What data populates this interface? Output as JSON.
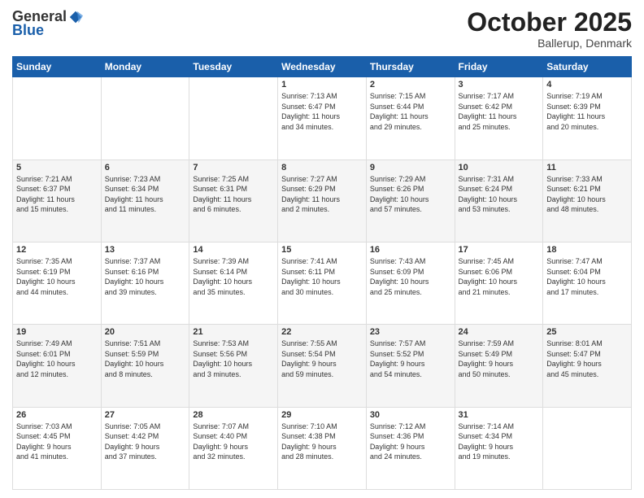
{
  "logo": {
    "general": "General",
    "blue": "Blue"
  },
  "header": {
    "month": "October 2025",
    "location": "Ballerup, Denmark"
  },
  "days_of_week": [
    "Sunday",
    "Monday",
    "Tuesday",
    "Wednesday",
    "Thursday",
    "Friday",
    "Saturday"
  ],
  "weeks": [
    [
      {
        "day": "",
        "info": ""
      },
      {
        "day": "",
        "info": ""
      },
      {
        "day": "",
        "info": ""
      },
      {
        "day": "1",
        "info": "Sunrise: 7:13 AM\nSunset: 6:47 PM\nDaylight: 11 hours\nand 34 minutes."
      },
      {
        "day": "2",
        "info": "Sunrise: 7:15 AM\nSunset: 6:44 PM\nDaylight: 11 hours\nand 29 minutes."
      },
      {
        "day": "3",
        "info": "Sunrise: 7:17 AM\nSunset: 6:42 PM\nDaylight: 11 hours\nand 25 minutes."
      },
      {
        "day": "4",
        "info": "Sunrise: 7:19 AM\nSunset: 6:39 PM\nDaylight: 11 hours\nand 20 minutes."
      }
    ],
    [
      {
        "day": "5",
        "info": "Sunrise: 7:21 AM\nSunset: 6:37 PM\nDaylight: 11 hours\nand 15 minutes."
      },
      {
        "day": "6",
        "info": "Sunrise: 7:23 AM\nSunset: 6:34 PM\nDaylight: 11 hours\nand 11 minutes."
      },
      {
        "day": "7",
        "info": "Sunrise: 7:25 AM\nSunset: 6:31 PM\nDaylight: 11 hours\nand 6 minutes."
      },
      {
        "day": "8",
        "info": "Sunrise: 7:27 AM\nSunset: 6:29 PM\nDaylight: 11 hours\nand 2 minutes."
      },
      {
        "day": "9",
        "info": "Sunrise: 7:29 AM\nSunset: 6:26 PM\nDaylight: 10 hours\nand 57 minutes."
      },
      {
        "day": "10",
        "info": "Sunrise: 7:31 AM\nSunset: 6:24 PM\nDaylight: 10 hours\nand 53 minutes."
      },
      {
        "day": "11",
        "info": "Sunrise: 7:33 AM\nSunset: 6:21 PM\nDaylight: 10 hours\nand 48 minutes."
      }
    ],
    [
      {
        "day": "12",
        "info": "Sunrise: 7:35 AM\nSunset: 6:19 PM\nDaylight: 10 hours\nand 44 minutes."
      },
      {
        "day": "13",
        "info": "Sunrise: 7:37 AM\nSunset: 6:16 PM\nDaylight: 10 hours\nand 39 minutes."
      },
      {
        "day": "14",
        "info": "Sunrise: 7:39 AM\nSunset: 6:14 PM\nDaylight: 10 hours\nand 35 minutes."
      },
      {
        "day": "15",
        "info": "Sunrise: 7:41 AM\nSunset: 6:11 PM\nDaylight: 10 hours\nand 30 minutes."
      },
      {
        "day": "16",
        "info": "Sunrise: 7:43 AM\nSunset: 6:09 PM\nDaylight: 10 hours\nand 25 minutes."
      },
      {
        "day": "17",
        "info": "Sunrise: 7:45 AM\nSunset: 6:06 PM\nDaylight: 10 hours\nand 21 minutes."
      },
      {
        "day": "18",
        "info": "Sunrise: 7:47 AM\nSunset: 6:04 PM\nDaylight: 10 hours\nand 17 minutes."
      }
    ],
    [
      {
        "day": "19",
        "info": "Sunrise: 7:49 AM\nSunset: 6:01 PM\nDaylight: 10 hours\nand 12 minutes."
      },
      {
        "day": "20",
        "info": "Sunrise: 7:51 AM\nSunset: 5:59 PM\nDaylight: 10 hours\nand 8 minutes."
      },
      {
        "day": "21",
        "info": "Sunrise: 7:53 AM\nSunset: 5:56 PM\nDaylight: 10 hours\nand 3 minutes."
      },
      {
        "day": "22",
        "info": "Sunrise: 7:55 AM\nSunset: 5:54 PM\nDaylight: 9 hours\nand 59 minutes."
      },
      {
        "day": "23",
        "info": "Sunrise: 7:57 AM\nSunset: 5:52 PM\nDaylight: 9 hours\nand 54 minutes."
      },
      {
        "day": "24",
        "info": "Sunrise: 7:59 AM\nSunset: 5:49 PM\nDaylight: 9 hours\nand 50 minutes."
      },
      {
        "day": "25",
        "info": "Sunrise: 8:01 AM\nSunset: 5:47 PM\nDaylight: 9 hours\nand 45 minutes."
      }
    ],
    [
      {
        "day": "26",
        "info": "Sunrise: 7:03 AM\nSunset: 4:45 PM\nDaylight: 9 hours\nand 41 minutes."
      },
      {
        "day": "27",
        "info": "Sunrise: 7:05 AM\nSunset: 4:42 PM\nDaylight: 9 hours\nand 37 minutes."
      },
      {
        "day": "28",
        "info": "Sunrise: 7:07 AM\nSunset: 4:40 PM\nDaylight: 9 hours\nand 32 minutes."
      },
      {
        "day": "29",
        "info": "Sunrise: 7:10 AM\nSunset: 4:38 PM\nDaylight: 9 hours\nand 28 minutes."
      },
      {
        "day": "30",
        "info": "Sunrise: 7:12 AM\nSunset: 4:36 PM\nDaylight: 9 hours\nand 24 minutes."
      },
      {
        "day": "31",
        "info": "Sunrise: 7:14 AM\nSunset: 4:34 PM\nDaylight: 9 hours\nand 19 minutes."
      },
      {
        "day": "",
        "info": ""
      }
    ]
  ]
}
